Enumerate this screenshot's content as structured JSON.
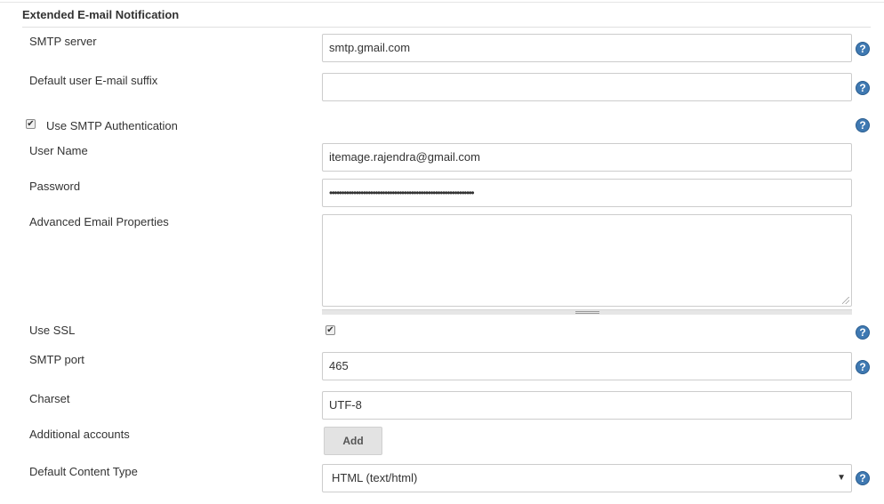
{
  "section": {
    "title": "Extended E-mail Notification"
  },
  "help_glyph": "?",
  "check_glyph": "✔",
  "smtp_server": {
    "label": "SMTP server",
    "value": "smtp.gmail.com"
  },
  "email_suffix": {
    "label": "Default user E-mail suffix",
    "value": ""
  },
  "smtp_auth": {
    "label": "Use SMTP Authentication",
    "checked": true
  },
  "username": {
    "label": "User Name",
    "value": "itemage.rajendra@gmail.com"
  },
  "password": {
    "label": "Password",
    "value": "••••••••••••••••••••••••••••••••••••••••••••••••••••••••••••"
  },
  "advanced_props": {
    "label": "Advanced Email Properties",
    "value": ""
  },
  "use_ssl": {
    "label": "Use SSL",
    "checked": true
  },
  "smtp_port": {
    "label": "SMTP port",
    "value": "465"
  },
  "charset": {
    "label": "Charset",
    "value": "UTF-8"
  },
  "additional_accounts": {
    "label": "Additional accounts",
    "button_label": "Add"
  },
  "content_type": {
    "label": "Default Content Type",
    "value": "HTML (text/html)",
    "arrow": "▼"
  },
  "colors": {
    "help": "#3f79b2",
    "border": "#cccccc",
    "text": "#333333"
  }
}
